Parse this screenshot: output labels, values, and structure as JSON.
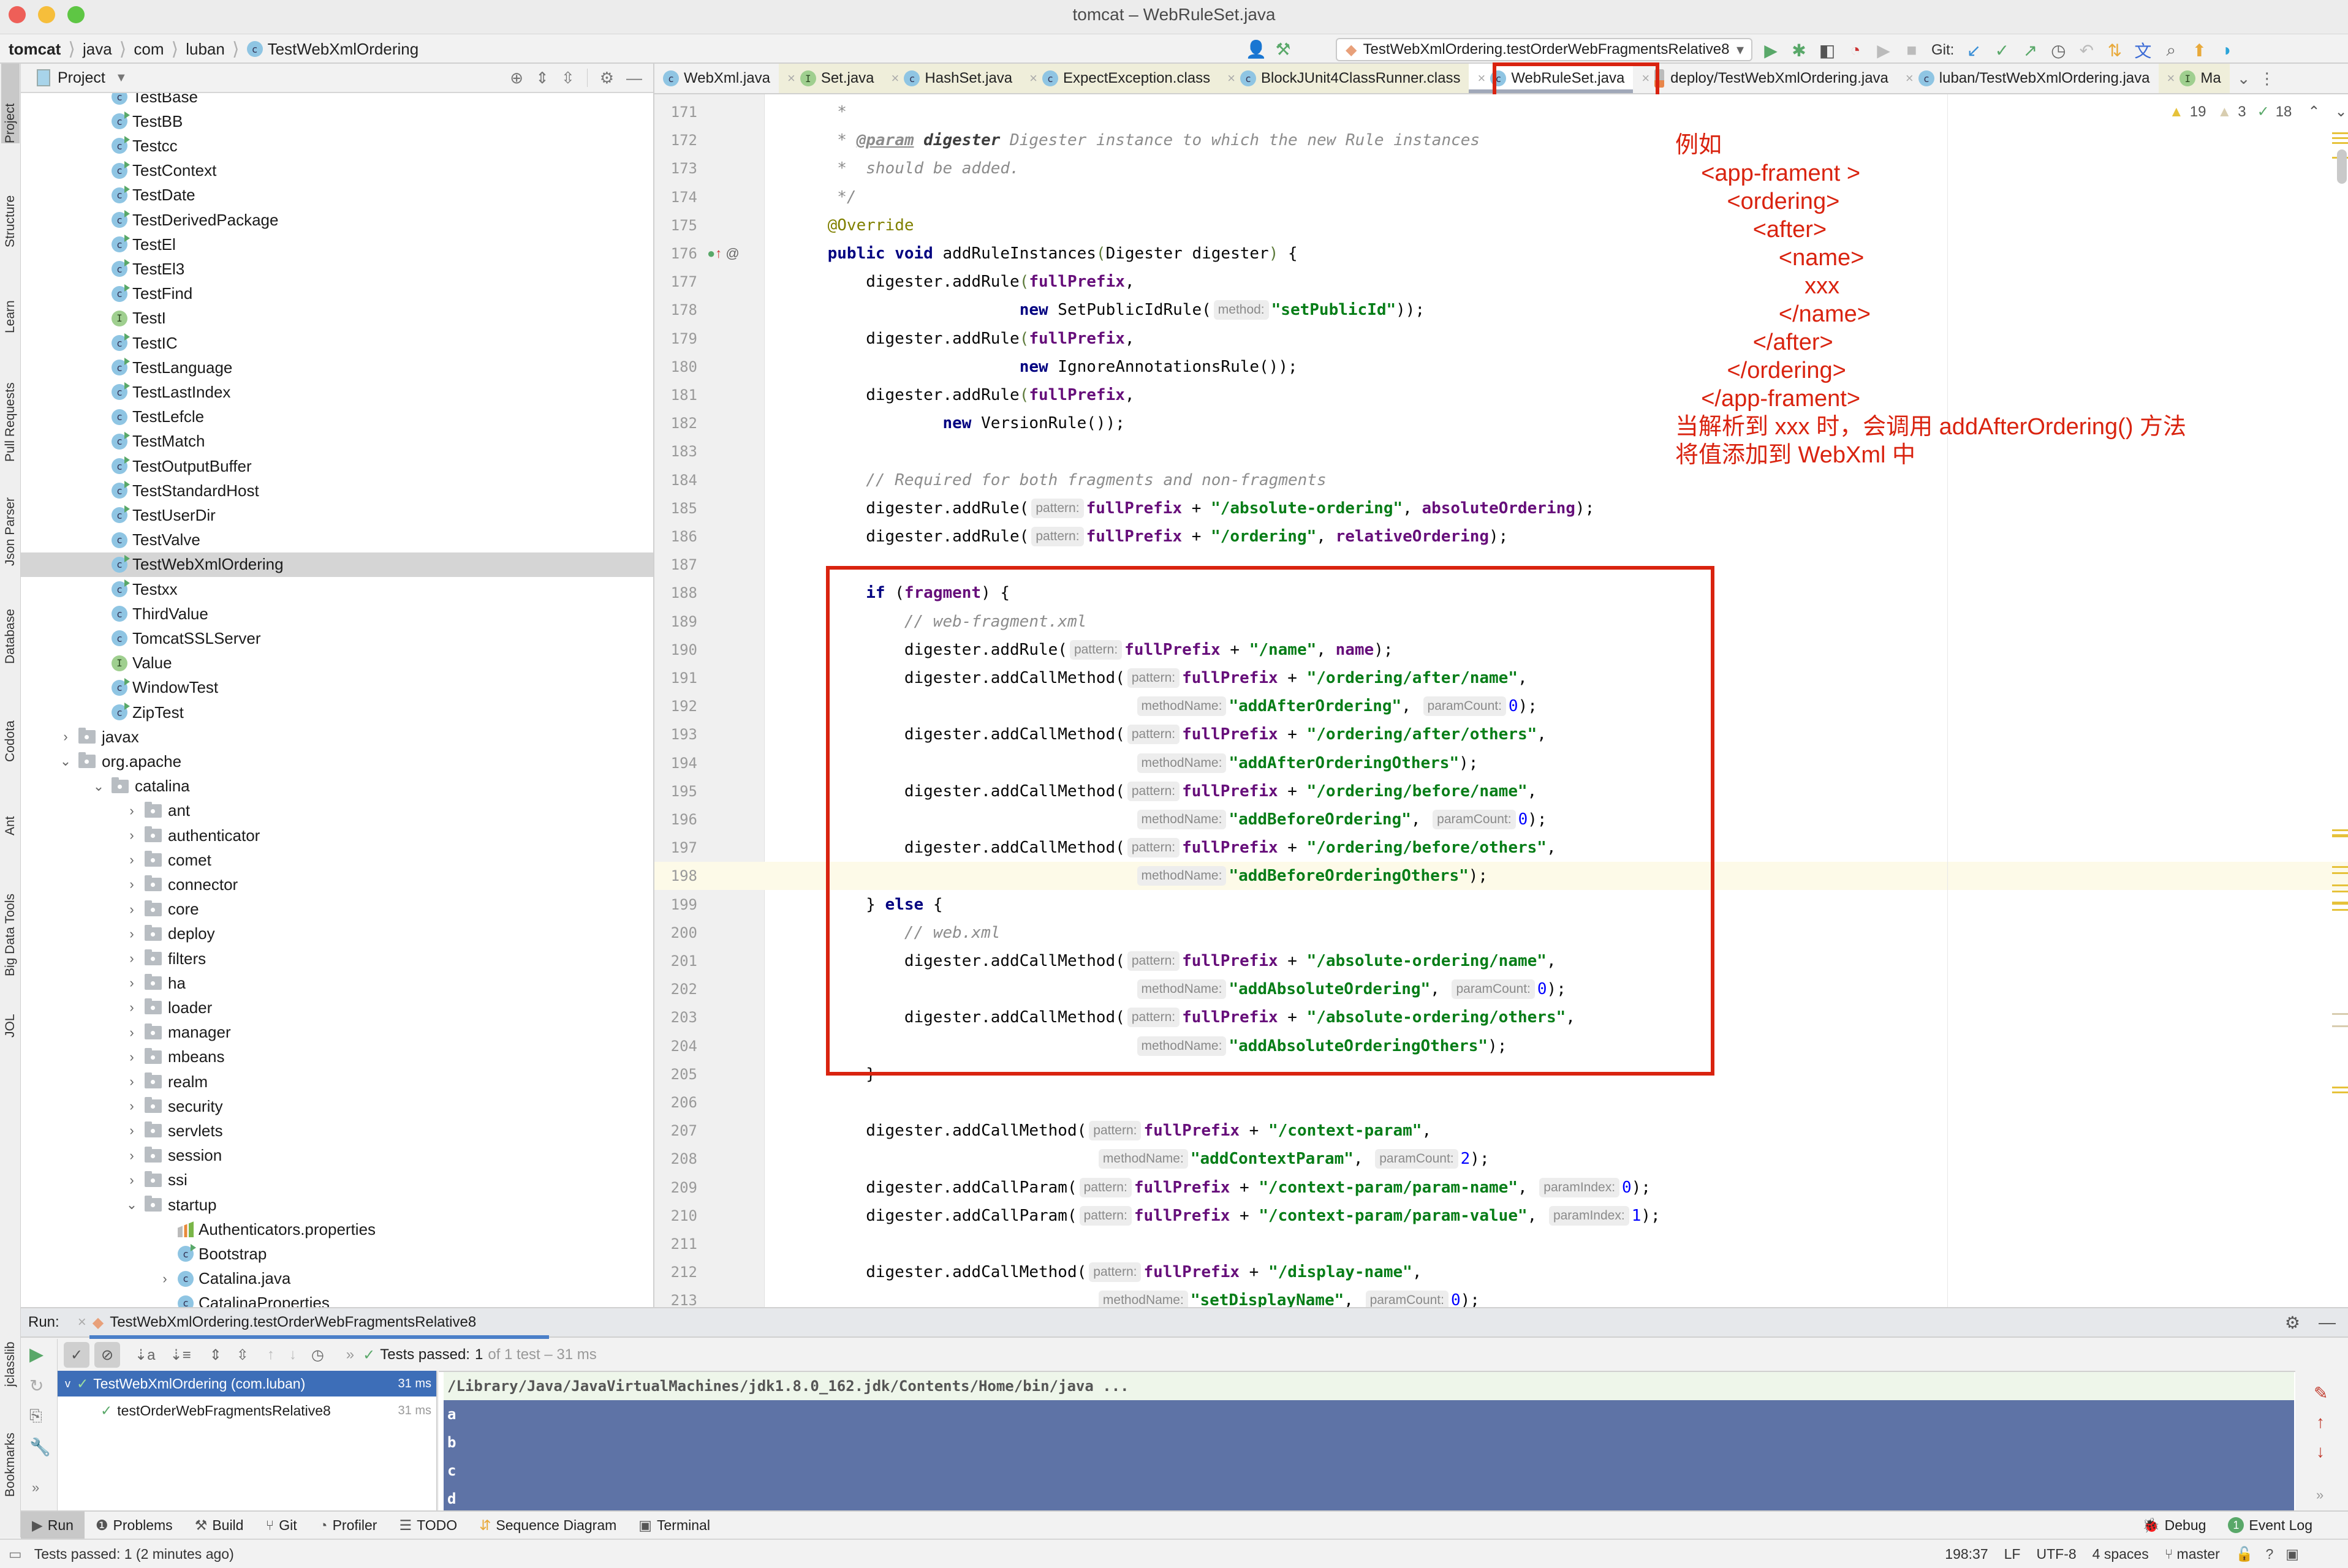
{
  "window": {
    "title": "tomcat – WebRuleSet.java",
    "traffic_colors": [
      "#ee5f58",
      "#f6be3b",
      "#5ec644"
    ]
  },
  "breadcrumb": [
    "tomcat",
    "java",
    "com",
    "luban",
    "TestWebXmlOrdering"
  ],
  "toolbar": {
    "run_config": "TestWebXmlOrdering.testOrderWebFragmentsRelative8",
    "git_label": "Git:"
  },
  "left_tool_tabs": [
    "Project",
    "Structure",
    "Learn",
    "Pull Requests",
    "Json Parser",
    "Database",
    "Codota",
    "Ant",
    "Big Data Tools",
    "JOL",
    "jclasslib",
    "Bookmarks"
  ],
  "project": {
    "title": "Project",
    "tree": [
      {
        "label": "TestBase",
        "kind": "class",
        "runnable": false,
        "depth": 3
      },
      {
        "label": "TestBB",
        "kind": "class",
        "runnable": true,
        "depth": 3
      },
      {
        "label": "Testcc",
        "kind": "class",
        "runnable": true,
        "depth": 3
      },
      {
        "label": "TestContext",
        "kind": "class",
        "runnable": true,
        "depth": 3
      },
      {
        "label": "TestDate",
        "kind": "class",
        "runnable": true,
        "depth": 3
      },
      {
        "label": "TestDerivedPackage",
        "kind": "class",
        "runnable": true,
        "depth": 3
      },
      {
        "label": "TestEl",
        "kind": "class",
        "runnable": true,
        "depth": 3
      },
      {
        "label": "TestEl3",
        "kind": "class",
        "runnable": true,
        "depth": 3
      },
      {
        "label": "TestFind",
        "kind": "class",
        "runnable": true,
        "depth": 3
      },
      {
        "label": "TestI",
        "kind": "interface",
        "runnable": false,
        "depth": 3
      },
      {
        "label": "TestIC",
        "kind": "class",
        "runnable": true,
        "depth": 3
      },
      {
        "label": "TestLanguage",
        "kind": "class",
        "runnable": true,
        "depth": 3
      },
      {
        "label": "TestLastIndex",
        "kind": "class",
        "runnable": true,
        "depth": 3
      },
      {
        "label": "TestLefcle",
        "kind": "class",
        "runnable": false,
        "depth": 3
      },
      {
        "label": "TestMatch",
        "kind": "class",
        "runnable": true,
        "depth": 3
      },
      {
        "label": "TestOutputBuffer",
        "kind": "class",
        "runnable": true,
        "depth": 3
      },
      {
        "label": "TestStandardHost",
        "kind": "class",
        "runnable": true,
        "depth": 3
      },
      {
        "label": "TestUserDir",
        "kind": "class",
        "runnable": true,
        "depth": 3
      },
      {
        "label": "TestValve",
        "kind": "class",
        "runnable": false,
        "depth": 3
      },
      {
        "label": "TestWebXmlOrdering",
        "kind": "class",
        "runnable": true,
        "depth": 3,
        "selected": true
      },
      {
        "label": "Testxx",
        "kind": "class",
        "runnable": true,
        "depth": 3
      },
      {
        "label": "ThirdValue",
        "kind": "class",
        "runnable": false,
        "depth": 3
      },
      {
        "label": "TomcatSSLServer",
        "kind": "class",
        "runnable": false,
        "depth": 3
      },
      {
        "label": "Value",
        "kind": "interface",
        "runnable": false,
        "depth": 3
      },
      {
        "label": "WindowTest",
        "kind": "class",
        "runnable": true,
        "depth": 3
      },
      {
        "label": "ZipTest",
        "kind": "class",
        "runnable": true,
        "depth": 3
      },
      {
        "label": "javax",
        "kind": "folder",
        "expanded": false,
        "depth": 2
      },
      {
        "label": "org.apache",
        "kind": "folder",
        "expanded": true,
        "depth": 2
      },
      {
        "label": "catalina",
        "kind": "folder",
        "expanded": true,
        "depth": 3
      },
      {
        "label": "ant",
        "kind": "folder",
        "expanded": false,
        "depth": 4
      },
      {
        "label": "authenticator",
        "kind": "folder",
        "expanded": false,
        "depth": 4
      },
      {
        "label": "comet",
        "kind": "folder",
        "expanded": false,
        "depth": 4
      },
      {
        "label": "connector",
        "kind": "folder",
        "expanded": false,
        "depth": 4
      },
      {
        "label": "core",
        "kind": "folder",
        "expanded": false,
        "depth": 4
      },
      {
        "label": "deploy",
        "kind": "folder",
        "expanded": false,
        "depth": 4
      },
      {
        "label": "filters",
        "kind": "folder",
        "expanded": false,
        "depth": 4
      },
      {
        "label": "ha",
        "kind": "folder",
        "expanded": false,
        "depth": 4
      },
      {
        "label": "loader",
        "kind": "folder",
        "expanded": false,
        "depth": 4
      },
      {
        "label": "manager",
        "kind": "folder",
        "expanded": false,
        "depth": 4
      },
      {
        "label": "mbeans",
        "kind": "folder",
        "expanded": false,
        "depth": 4
      },
      {
        "label": "realm",
        "kind": "folder",
        "expanded": false,
        "depth": 4
      },
      {
        "label": "security",
        "kind": "folder",
        "expanded": false,
        "depth": 4
      },
      {
        "label": "servlets",
        "kind": "folder",
        "expanded": false,
        "depth": 4
      },
      {
        "label": "session",
        "kind": "folder",
        "expanded": false,
        "depth": 4
      },
      {
        "label": "ssi",
        "kind": "folder",
        "expanded": false,
        "depth": 4
      },
      {
        "label": "startup",
        "kind": "folder",
        "expanded": true,
        "depth": 4
      },
      {
        "label": "Authenticators.properties",
        "kind": "properties",
        "depth": 5
      },
      {
        "label": "Bootstrap",
        "kind": "class",
        "runnable": true,
        "depth": 5
      },
      {
        "label": "Catalina.java",
        "kind": "class",
        "runnable": false,
        "depth": 5,
        "collapsible": true
      },
      {
        "label": "CatalinaProperties",
        "kind": "class",
        "runnable": false,
        "depth": 5
      }
    ]
  },
  "editor_tabs": [
    {
      "label": "WebXml.java",
      "kind": "class",
      "tinted": false
    },
    {
      "label": "Set.java",
      "kind": "interface",
      "tinted": true
    },
    {
      "label": "HashSet.java",
      "kind": "class",
      "tinted": true
    },
    {
      "label": "ExpectException.class",
      "kind": "class",
      "tinted": true
    },
    {
      "label": "BlockJUnit4ClassRunner.class",
      "kind": "class",
      "tinted": true
    },
    {
      "label": "WebRuleSet.java",
      "kind": "class",
      "active": true
    },
    {
      "label": "deploy/TestWebXmlOrdering.java",
      "kind": "java",
      "tinted": false
    },
    {
      "label": "luban/TestWebXmlOrdering.java",
      "kind": "class",
      "tinted": false
    },
    {
      "label": "Ma",
      "kind": "interface",
      "tinted": true
    }
  ],
  "inspections": {
    "warnings": "19",
    "weak_warnings": "3",
    "typos": "18"
  },
  "code": {
    "lines": [
      {
        "n": "171",
        "html": "     <span class='cmt'>*</span>"
      },
      {
        "n": "172",
        "html": "     <span class='cmt'>* </span><span class='doctag'>@param</span> <span class='docparam'>digester</span><span class='cmt'> Digester instance to which the new Rule instances</span>"
      },
      {
        "n": "173",
        "html": "     <span class='cmt'>*  should be added.</span>"
      },
      {
        "n": "174",
        "html": "     <span class='cmt'>*/</span>"
      },
      {
        "n": "175",
        "html": "    <span class='ann'>@Override</span>"
      },
      {
        "n": "176",
        "html": "    <span class='kw'>public void</span> addRuleInstances<span class='paren'>(</span>Digester digester<span class='paren'>)</span> {"
      },
      {
        "n": "177",
        "html": "        digester.addRule<span class='paren'>(</span><span class='field'>fullPrefix</span>,"
      },
      {
        "n": "178",
        "html": "                        <span class='kw'>new</span> SetPublicIdRule(<span class='hint'>method:</span><span class='str'>\"setPublicId\"</span>));"
      },
      {
        "n": "179",
        "html": "        digester.addRule<span class='paren'>(</span><span class='field'>fullPrefix</span>,"
      },
      {
        "n": "180",
        "html": "                        <span class='kw'>new</span> IgnoreAnnotationsRule());"
      },
      {
        "n": "181",
        "html": "        digester.addRule<span class='paren'>(</span><span class='field'>fullPrefix</span>,"
      },
      {
        "n": "182",
        "html": "                <span class='kw'>new</span> VersionRule());"
      },
      {
        "n": "183",
        "html": ""
      },
      {
        "n": "184",
        "html": "        <span class='cmt'>// Required for both fragments and non-fragments</span>"
      },
      {
        "n": "185",
        "html": "        digester.addRule(<span class='hint'>pattern:</span><span class='field'>fullPrefix</span> + <span class='str'>\"/absolute-ordering\"</span>, <span class='field'>absoluteOrdering</span>);"
      },
      {
        "n": "186",
        "html": "        digester.addRule(<span class='hint'>pattern:</span><span class='field'>fullPrefix</span> + <span class='str'>\"/ordering\"</span>, <span class='field'>relativeOrdering</span>);"
      },
      {
        "n": "187",
        "html": ""
      },
      {
        "n": "188",
        "html": "        <span class='kw'>if</span> (<span class='field'>fragment</span>) {"
      },
      {
        "n": "189",
        "html": "            <span class='cmt'>// web-fragment.xml</span>"
      },
      {
        "n": "190",
        "html": "            digester.addRule(<span class='hint'>pattern:</span><span class='field'>fullPrefix</span> + <span class='str'>\"/name\"</span>, <span class='field'>name</span>);"
      },
      {
        "n": "191",
        "html": "            digester.addCallMethod(<span class='hint'>pattern:</span><span class='field'>fullPrefix</span> + <span class='str'>\"/ordering/after/name\"</span>,"
      },
      {
        "n": "192",
        "html": "                                    <span class='hint'>methodName:</span><span class='str'>\"addAfterOrdering\"</span>, <span class='hint'>paramCount:</span><span class='num'>0</span>);"
      },
      {
        "n": "193",
        "html": "            digester.addCallMethod(<span class='hint'>pattern:</span><span class='field'>fullPrefix</span> + <span class='str'>\"/ordering/after/others\"</span>,"
      },
      {
        "n": "194",
        "html": "                                    <span class='hint'>methodName:</span><span class='str'>\"addAfterOrderingOthers\"</span>);"
      },
      {
        "n": "195",
        "html": "            digester.addCallMethod(<span class='hint'>pattern:</span><span class='field'>fullPrefix</span> + <span class='str'>\"/ordering/before/name\"</span>,"
      },
      {
        "n": "196",
        "html": "                                    <span class='hint'>methodName:</span><span class='str'>\"addBeforeOrdering\"</span>, <span class='hint'>paramCount:</span><span class='num'>0</span>);"
      },
      {
        "n": "197",
        "html": "            digester.addCallMethod(<span class='hint'>pattern:</span><span class='field'>fullPrefix</span> + <span class='str'>\"/ordering/before/others\"</span>,"
      },
      {
        "n": "198",
        "html": "                                    <span class='hint'>methodName:</span><span class='str'>\"addBeforeOrderingOthers\"</span>);",
        "current": true
      },
      {
        "n": "199",
        "html": "        } <span class='kw'>else</span> {"
      },
      {
        "n": "200",
        "html": "            <span class='cmt'>// web.xml</span>"
      },
      {
        "n": "201",
        "html": "            digester.addCallMethod(<span class='hint'>pattern:</span><span class='field'>fullPrefix</span> + <span class='str'>\"/absolute-ordering/name\"</span>,"
      },
      {
        "n": "202",
        "html": "                                    <span class='hint'>methodName:</span><span class='str'>\"addAbsoluteOrdering\"</span>, <span class='hint'>paramCount:</span><span class='num'>0</span>);"
      },
      {
        "n": "203",
        "html": "            digester.addCallMethod(<span class='hint'>pattern:</span><span class='field'>fullPrefix</span> + <span class='str'>\"/absolute-ordering/others\"</span>,"
      },
      {
        "n": "204",
        "html": "                                    <span class='hint'>methodName:</span><span class='str'>\"addAbsoluteOrderingOthers\"</span>);"
      },
      {
        "n": "205",
        "html": "        }"
      },
      {
        "n": "206",
        "html": ""
      },
      {
        "n": "207",
        "html": "        digester.addCallMethod(<span class='hint'>pattern:</span><span class='field'>fullPrefix</span> + <span class='str'>\"/context-param\"</span>,"
      },
      {
        "n": "208",
        "html": "                                <span class='hint'>methodName:</span><span class='str'>\"addContextParam\"</span>, <span class='hint'>paramCount:</span><span class='num'>2</span>);"
      },
      {
        "n": "209",
        "html": "        digester.addCallParam(<span class='hint'>pattern:</span><span class='field'>fullPrefix</span> + <span class='str'>\"/context-param/param-name\"</span>, <span class='hint'>paramIndex:</span><span class='num'>0</span>);"
      },
      {
        "n": "210",
        "html": "        digester.addCallParam(<span class='hint'>pattern:</span><span class='field'>fullPrefix</span> + <span class='str'>\"/context-param/param-value\"</span>, <span class='hint'>paramIndex:</span><span class='num'>1</span>);"
      },
      {
        "n": "211",
        "html": ""
      },
      {
        "n": "212",
        "html": "        digester.addCallMethod(<span class='hint'>pattern:</span><span class='field'>fullPrefix</span> + <span class='str'>\"/display-name\"</span>,"
      },
      {
        "n": "213",
        "html": "                                <span class='hint'>methodName:</span><span class='str'>\"setDisplayName\"</span>, <span class='hint'>paramCount:</span><span class='num'>0</span>);"
      }
    ]
  },
  "annotation": {
    "color": "#d9230f",
    "lines": [
      "例如",
      "    <app-frament >",
      "        <ordering>",
      "            <after>",
      "                <name>",
      "                    xxx",
      "                </name>",
      "            </after>",
      "        </ordering>",
      "    </app-frament>",
      "当解析到 xxx 时，会调用 addAfterOrdering() 方法",
      "将值添加到 WebXml 中"
    ]
  },
  "run_panel": {
    "label": "Run:",
    "tab": "TestWebXmlOrdering.testOrderWebFragmentsRelative8",
    "status_prefix": "Tests passed:",
    "status_count": "1",
    "status_suffix": "of 1 test – 31 ms",
    "tests": [
      {
        "label": "TestWebXmlOrdering (com.luban)",
        "time": "31 ms",
        "selected": true
      },
      {
        "label": "testOrderWebFragmentsRelative8",
        "time": "31 ms"
      }
    ],
    "console_command": "/Library/Java/JavaVirtualMachines/jdk1.8.0_162.jdk/Contents/Home/bin/java ...",
    "console_output": [
      "a",
      "b",
      "c",
      "d"
    ]
  },
  "bottom_tabs": {
    "left": [
      "Run",
      "Problems",
      "Build",
      "Git",
      "Profiler",
      "TODO",
      "Sequence Diagram",
      "Terminal"
    ],
    "right": [
      "Debug",
      "Event Log"
    ],
    "event_log_count": "1"
  },
  "status_bar": {
    "message": "Tests passed: 1 (2 minutes ago)",
    "position": "198:37",
    "line_separator": "LF",
    "encoding": "UTF-8",
    "indent": "4 spaces",
    "branch": "master"
  }
}
